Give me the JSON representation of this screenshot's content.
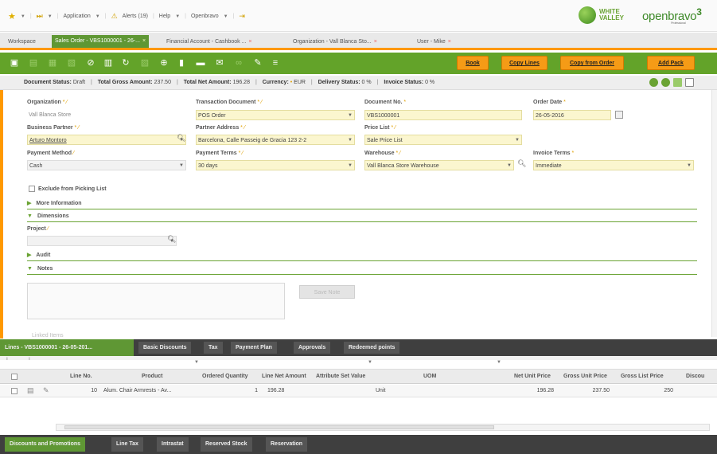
{
  "topbar": {
    "application_label": "Application",
    "alerts_label": "Alerts (19)",
    "help_label": "Help",
    "openbravo_label": "Openbravo",
    "logo_white_valley": [
      "WHITE",
      "VALLEY"
    ],
    "logo_openbravo": "openbravo",
    "logo_version": "3",
    "logo_professional": "Professional"
  },
  "window_tabs": [
    {
      "label": "Workspace"
    },
    {
      "label": "Sales Order - VBS1000001 - 26-...",
      "active": true
    },
    {
      "label": "Financial Account - Cashbook ..."
    },
    {
      "label": "Organization - Vall Blanca Sto..."
    },
    {
      "label": "User - Mike"
    }
  ],
  "toolbar": {
    "book_label": "Book",
    "copy_lines_label": "Copy Lines",
    "copy_from_order_label": "Copy from Order",
    "add_pack_label": "Add Pack"
  },
  "status": {
    "document_status_label": "Document Status:",
    "document_status": "Draft",
    "total_gross_label": "Total Gross Amount:",
    "total_gross": "237.50",
    "total_net_label": "Total Net Amount:",
    "total_net": "196.28",
    "currency_label": "Currency:",
    "currency": "EUR",
    "delivery_label": "Delivery Status:",
    "delivery": "0 %",
    "invoice_label": "Invoice Status:",
    "invoice": "0 %"
  },
  "form": {
    "organization": {
      "label": "Organization",
      "value": "Vall Blanca Store"
    },
    "transaction_document": {
      "label": "Transaction Document",
      "value": "POS Order"
    },
    "document_no": {
      "label": "Document No.",
      "value": "VBS1000001"
    },
    "order_date": {
      "label": "Order Date",
      "value": "26-05-2016"
    },
    "business_partner": {
      "label": "Business Partner",
      "value": "Arturo Montoro"
    },
    "partner_address": {
      "label": "Partner Address",
      "value": "Barcelona, Calle Passeig de Gracia 123 2-2"
    },
    "price_list": {
      "label": "Price List",
      "value": "Sale Price List"
    },
    "payment_method": {
      "label": "Payment Method",
      "value": "Cash"
    },
    "payment_terms": {
      "label": "Payment Terms",
      "value": "30 days"
    },
    "warehouse": {
      "label": "Warehouse",
      "value": "Vall Blanca Store Warehouse"
    },
    "invoice_terms": {
      "label": "Invoice Terms",
      "value": "Immediate"
    },
    "exclude_picking": "Exclude from Picking List",
    "project_label": "Project"
  },
  "sections": {
    "more_info": "More Information",
    "dimensions": "Dimensions",
    "audit": "Audit",
    "notes": "Notes",
    "save_note": "Save Note",
    "linked_items": "Linked Items"
  },
  "lines_tabs": [
    {
      "label": "Lines - VBS1000001 - 26-05-201...",
      "active": true
    },
    {
      "label": "Basic Discounts"
    },
    {
      "label": "Tax"
    },
    {
      "label": "Payment Plan"
    },
    {
      "label": "Approvals"
    },
    {
      "label": "Redeemed points"
    }
  ],
  "grid": {
    "columns": [
      "Line No.",
      "Product",
      "Ordered Quantity",
      "Line Net Amount",
      "Attribute Set Value",
      "UOM",
      "Net Unit Price",
      "Gross Unit Price",
      "Gross List Price",
      "Discou"
    ],
    "rows": [
      {
        "line_no": "10",
        "product": "Alum. Chair Armrests - Av...",
        "qty": "1",
        "net_amount": "196.28",
        "attr": "",
        "uom": "Unit",
        "net_unit": "196.28",
        "gross_unit": "237.50",
        "gross_list": "250",
        "discount": ""
      }
    ]
  },
  "bottom_tabs": [
    {
      "label": "Discounts and Promotions",
      "active": true
    },
    {
      "label": "Line Tax"
    },
    {
      "label": "Intrastat"
    },
    {
      "label": "Reserved Stock"
    },
    {
      "label": "Reservation"
    }
  ],
  "colors": {
    "brand_green": "#5f9734",
    "accent_orange": "#f59b16",
    "field_yellow": "#fbf6cf"
  }
}
